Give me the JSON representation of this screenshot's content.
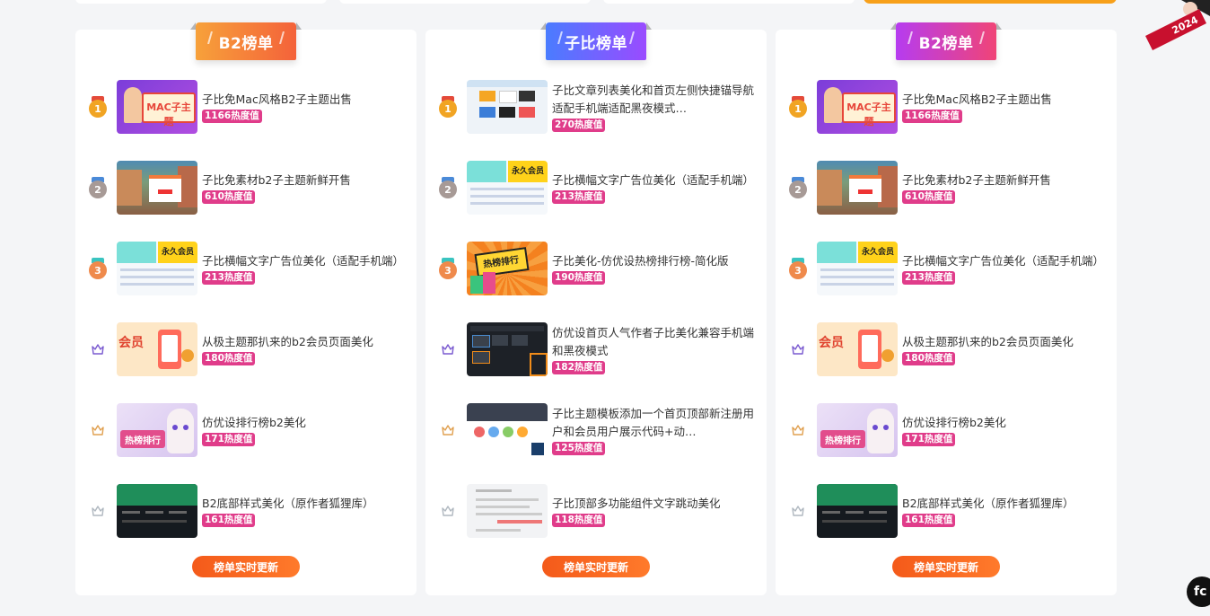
{
  "colors": {
    "hot_badge": "#e03c8a",
    "update_button": "#f45a1a",
    "ribbon_orange": [
      "#f7a13a",
      "#f4623a"
    ],
    "ribbon_blue": [
      "#4a7cff",
      "#9a4bff"
    ],
    "ribbon_magenta": [
      "#b63cf0",
      "#f04477"
    ],
    "gold": "#f1a423",
    "silver": "#a79a96",
    "bronze": "#ef8a4c"
  },
  "corner_badge_text": "2024",
  "side_button_label": "fc",
  "boards": [
    {
      "title": "B2榜单",
      "ribbon": "orange",
      "update_label": "榜单实时更新",
      "items": [
        {
          "rank": "1",
          "title": "子比免Mac风格B2子主题出售",
          "hot": "1166热度值",
          "thumb": "purple"
        },
        {
          "rank": "2",
          "title": "子比免素材b2子主题新鲜开售",
          "hot": "610热度值",
          "thumb": "street"
        },
        {
          "rank": "3",
          "title": "子比横幅文字广告位美化（适配手机端）",
          "hot": "213热度值",
          "thumb": "banner"
        },
        {
          "rank": "",
          "title": "从极主题那扒来的b2会员页面美化",
          "hot": "180热度值",
          "thumb": "member"
        },
        {
          "rank": "",
          "title": "仿优设排行榜b2美化",
          "hot": "171热度值",
          "thumb": "anime"
        },
        {
          "rank": "",
          "title": "B2底部样式美化（原作者狐狸库）",
          "hot": "161热度值",
          "thumb": "footer"
        }
      ]
    },
    {
      "title": "子比榜单",
      "ribbon": "blue",
      "update_label": "榜单实时更新",
      "items": [
        {
          "rank": "1",
          "title": "子比文章列表美化和首页左侧快捷锚导航适配手机端适配黑夜模式…",
          "hot": "270热度值",
          "thumb": "list"
        },
        {
          "rank": "2",
          "title": "子比横幅文字广告位美化（适配手机端）",
          "hot": "213热度值",
          "thumb": "banner"
        },
        {
          "rank": "3",
          "title": "子比美化-仿优设热榜排行榜-简化版",
          "hot": "190热度值",
          "thumb": "orange"
        },
        {
          "rank": "",
          "title": "仿优设首页人气作者子比美化兼容手机端和黑夜模式",
          "hot": "182热度值",
          "thumb": "dark"
        },
        {
          "rank": "",
          "title": "子比主题模板添加一个首页顶部新注册用户和会员用户展示代码+动…",
          "hot": "125热度值",
          "thumb": "users"
        },
        {
          "rank": "",
          "title": "子比顶部多功能组件文字跳动美化",
          "hot": "118热度值",
          "thumb": "doc"
        }
      ]
    },
    {
      "title": "B2榜单",
      "ribbon": "magenta",
      "update_label": "榜单实时更新",
      "items": [
        {
          "rank": "1",
          "title": "子比免Mac风格B2子主题出售",
          "hot": "1166热度值",
          "thumb": "purple"
        },
        {
          "rank": "2",
          "title": "子比免素材b2子主题新鲜开售",
          "hot": "610热度值",
          "thumb": "street"
        },
        {
          "rank": "3",
          "title": "子比横幅文字广告位美化（适配手机端）",
          "hot": "213热度值",
          "thumb": "banner"
        },
        {
          "rank": "",
          "title": "从极主题那扒来的b2会员页面美化",
          "hot": "180热度值",
          "thumb": "member"
        },
        {
          "rank": "",
          "title": "仿优设排行榜b2美化",
          "hot": "171热度值",
          "thumb": "anime"
        },
        {
          "rank": "",
          "title": "B2底部样式美化（原作者狐狸库）",
          "hot": "161热度值",
          "thumb": "footer"
        }
      ]
    }
  ],
  "thumb_texts": {
    "purple": "MAC子主题",
    "banner": "永久会员",
    "member": "会员",
    "anime": "热榜排行",
    "orange": "热榜排行"
  }
}
